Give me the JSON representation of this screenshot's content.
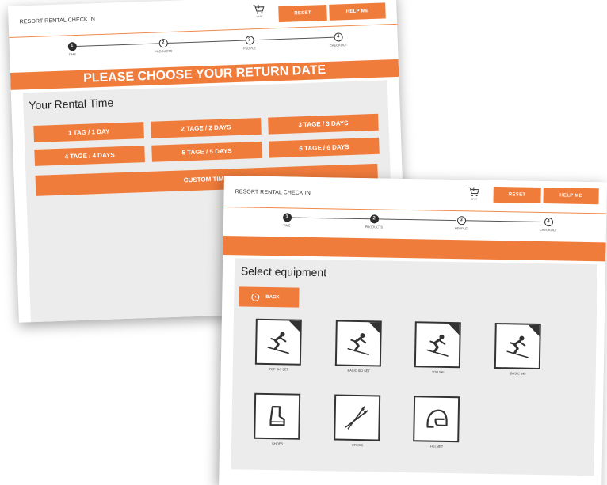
{
  "screen_time": {
    "app_title": "RESORT RENTAL CHECK IN",
    "cart_label": "CART",
    "reset_label": "RESET",
    "help_label": "HELP ME",
    "steps": [
      {
        "num": "1",
        "label": "TIME"
      },
      {
        "num": "2",
        "label": "PRODUCTS"
      },
      {
        "num": "3",
        "label": "PEOPLE"
      },
      {
        "num": "4",
        "label": "CHECKOUT"
      }
    ],
    "banner": "PLEASE CHOOSE YOUR RETURN DATE",
    "section_title": "Your Rental Time",
    "durations": [
      "1 TAG / 1 DAY",
      "2 TAGE / 2 DAYS",
      "3 TAGE / 3 DAYS",
      "4 TAGE / 4 DAYS",
      "5 TAGE / 5 DAYS",
      "6 TAGE / 6 DAYS"
    ],
    "custom_label": "CUSTOM TIME"
  },
  "screen_products": {
    "app_title": "RESORT RENTAL CHECK IN",
    "cart_label": "CART",
    "reset_label": "RESET",
    "help_label": "HELP ME",
    "steps": [
      {
        "num": "1",
        "label": "TIME"
      },
      {
        "num": "2",
        "label": "PRODUCTS"
      },
      {
        "num": "3",
        "label": "PEOPLE"
      },
      {
        "num": "4",
        "label": "CHECKOUT"
      }
    ],
    "section_title": "Select equipment",
    "back_label": "BACK",
    "equipment": [
      {
        "label": "TOP SKI SET",
        "icon": "skier-icon"
      },
      {
        "label": "BASIC SKI SET",
        "icon": "skier-icon"
      },
      {
        "label": "TOP SKI",
        "icon": "skier-icon"
      },
      {
        "label": "BASIC SKI",
        "icon": "skier-icon"
      },
      {
        "label": "SHOES",
        "icon": "ski-boot-icon"
      },
      {
        "label": "STICKS",
        "icon": "ski-poles-icon"
      },
      {
        "label": "HELMET",
        "icon": "helmet-icon"
      }
    ]
  },
  "colors": {
    "accent": "#f07c3c",
    "dark": "#2d2d2d",
    "panel": "#ececec"
  }
}
